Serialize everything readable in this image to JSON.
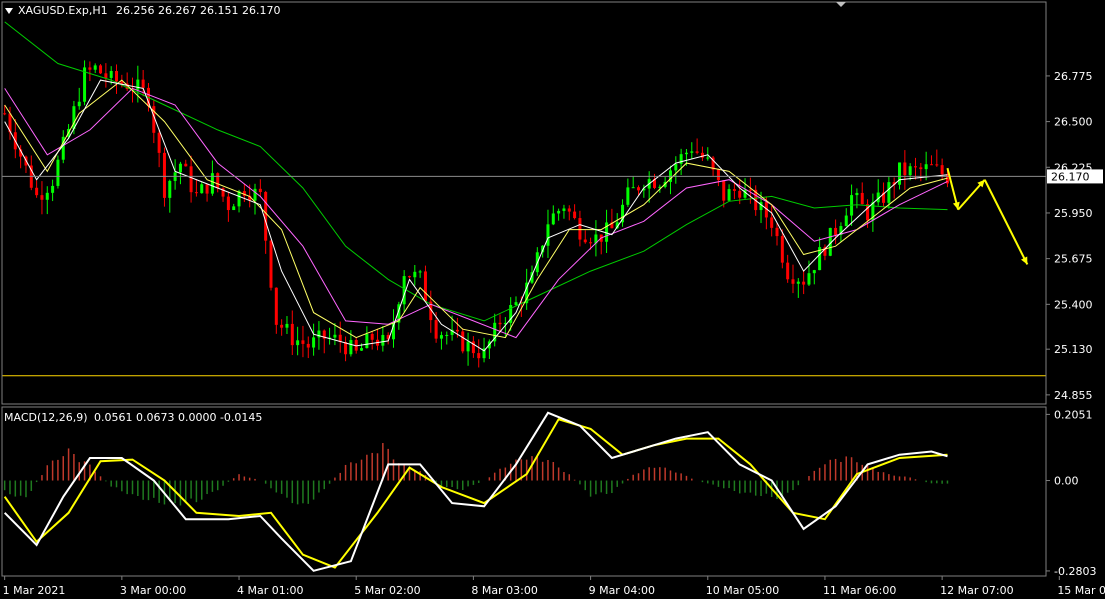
{
  "header": {
    "symbol": "XAGUSD.Exp,H1",
    "ohlc": "26.256 26.267 26.151 26.170"
  },
  "macd_header": {
    "label": "MACD(12,26,9)",
    "values": "0.0561 0.0673 0.0000 -0.0145"
  },
  "colors": {
    "background": "#000000",
    "bull_candle": "#00ff00",
    "bear_candle": "#ff0000",
    "ma_fast": "#ffffff",
    "ma_mid": "#ffff66",
    "ma_pink": "#ff66ff",
    "ma_slow": "#00cc00",
    "support_line": "#ffd700",
    "price_line": "#8c8c8c",
    "arrows": "#ffff00",
    "macd_line": "#ffffff",
    "signal_line": "#ffff00",
    "hist_pos": "#c0392b",
    "hist_neg": "#1f7a1f"
  },
  "icons": {
    "dropdown": "triangle-down-icon",
    "corner": "corner-triangle-icon"
  },
  "chart_data": [
    {
      "type": "line",
      "panel": "price",
      "title": "XAGUSD.Exp,H1",
      "y_ticks": [
        26.775,
        26.5,
        26.225,
        25.95,
        25.675,
        25.4,
        25.13,
        24.855
      ],
      "y_tick_labels": [
        "26.775",
        "26.500",
        "26.225",
        "25.950",
        "25.675",
        "25.400",
        "25.130",
        "24.855"
      ],
      "ylim": [
        24.8,
        27.22
      ],
      "current_price": 26.17,
      "current_price_label": "26.170",
      "support_level": 24.97,
      "x_labels": [
        "1 Mar 2021",
        "3 Mar 00:00",
        "4 Mar 01:00",
        "5 Mar 02:00",
        "8 Mar 03:00",
        "9 Mar 04:00",
        "10 Mar 05:00",
        "11 Mar 06:00",
        "12 Mar 07:00",
        "15 Mar 07:00"
      ],
      "close_path": [
        [
          0,
          26.55
        ],
        [
          3,
          26.3
        ],
        [
          6,
          26.05
        ],
        [
          9,
          26.15
        ],
        [
          12,
          26.45
        ],
        [
          15,
          26.78
        ],
        [
          17,
          26.82
        ],
        [
          20,
          26.75
        ],
        [
          24,
          26.72
        ],
        [
          27,
          26.65
        ],
        [
          30,
          26.1
        ],
        [
          33,
          26.25
        ],
        [
          36,
          26.05
        ],
        [
          39,
          26.15
        ],
        [
          42,
          26.0
        ],
        [
          45,
          26.1
        ],
        [
          48,
          26.05
        ],
        [
          51,
          25.3
        ],
        [
          54,
          25.2
        ],
        [
          57,
          25.15
        ],
        [
          60,
          25.2
        ],
        [
          63,
          25.18
        ],
        [
          66,
          25.1
        ],
        [
          69,
          25.2
        ],
        [
          72,
          25.15
        ],
        [
          75,
          25.6
        ],
        [
          78,
          25.55
        ],
        [
          81,
          25.25
        ],
        [
          84,
          25.2
        ],
        [
          87,
          25.15
        ],
        [
          90,
          25.1
        ],
        [
          93,
          25.3
        ],
        [
          96,
          25.4
        ],
        [
          99,
          25.55
        ],
        [
          102,
          25.9
        ],
        [
          105,
          26.0
        ],
        [
          108,
          25.85
        ],
        [
          111,
          25.8
        ],
        [
          114,
          25.85
        ],
        [
          117,
          26.05
        ],
        [
          120,
          26.15
        ],
        [
          123,
          26.15
        ],
        [
          126,
          26.25
        ],
        [
          129,
          26.35
        ],
        [
          132,
          26.25
        ],
        [
          135,
          26.05
        ],
        [
          138,
          26.1
        ],
        [
          141,
          26.0
        ],
        [
          144,
          25.9
        ],
        [
          147,
          25.6
        ],
        [
          150,
          25.55
        ],
        [
          153,
          25.7
        ],
        [
          156,
          25.85
        ],
        [
          159,
          26.05
        ],
        [
          162,
          25.95
        ],
        [
          165,
          26.05
        ],
        [
          168,
          26.2
        ],
        [
          171,
          26.2
        ],
        [
          174,
          26.22
        ],
        [
          177,
          26.17
        ]
      ],
      "ma_fast": [
        [
          0,
          26.5
        ],
        [
          6,
          26.15
        ],
        [
          12,
          26.4
        ],
        [
          18,
          26.75
        ],
        [
          26,
          26.7
        ],
        [
          32,
          26.2
        ],
        [
          40,
          26.1
        ],
        [
          48,
          26.0
        ],
        [
          52,
          25.6
        ],
        [
          58,
          25.22
        ],
        [
          66,
          25.15
        ],
        [
          72,
          25.18
        ],
        [
          76,
          25.55
        ],
        [
          82,
          25.28
        ],
        [
          90,
          25.12
        ],
        [
          96,
          25.35
        ],
        [
          102,
          25.8
        ],
        [
          108,
          25.88
        ],
        [
          114,
          25.82
        ],
        [
          120,
          26.1
        ],
        [
          126,
          26.25
        ],
        [
          132,
          26.3
        ],
        [
          138,
          26.1
        ],
        [
          144,
          25.95
        ],
        [
          150,
          25.6
        ],
        [
          156,
          25.8
        ],
        [
          162,
          25.98
        ],
        [
          168,
          26.15
        ],
        [
          177,
          26.18
        ]
      ],
      "ma_mid": [
        [
          0,
          26.6
        ],
        [
          8,
          26.2
        ],
        [
          14,
          26.55
        ],
        [
          22,
          26.75
        ],
        [
          30,
          26.5
        ],
        [
          38,
          26.15
        ],
        [
          46,
          26.05
        ],
        [
          52,
          25.85
        ],
        [
          58,
          25.35
        ],
        [
          66,
          25.2
        ],
        [
          74,
          25.3
        ],
        [
          78,
          25.5
        ],
        [
          86,
          25.25
        ],
        [
          94,
          25.2
        ],
        [
          100,
          25.55
        ],
        [
          106,
          25.85
        ],
        [
          112,
          25.85
        ],
        [
          120,
          26.0
        ],
        [
          128,
          26.25
        ],
        [
          136,
          26.2
        ],
        [
          144,
          26.0
        ],
        [
          150,
          25.7
        ],
        [
          156,
          25.75
        ],
        [
          164,
          25.95
        ],
        [
          170,
          26.1
        ],
        [
          177,
          26.16
        ]
      ],
      "ma_pink": [
        [
          0,
          26.7
        ],
        [
          8,
          26.3
        ],
        [
          16,
          26.45
        ],
        [
          24,
          26.7
        ],
        [
          32,
          26.6
        ],
        [
          40,
          26.25
        ],
        [
          48,
          26.05
        ],
        [
          56,
          25.75
        ],
        [
          64,
          25.3
        ],
        [
          72,
          25.28
        ],
        [
          80,
          25.4
        ],
        [
          88,
          25.3
        ],
        [
          96,
          25.2
        ],
        [
          104,
          25.55
        ],
        [
          112,
          25.8
        ],
        [
          120,
          25.9
        ],
        [
          128,
          26.1
        ],
        [
          136,
          26.15
        ],
        [
          144,
          26.0
        ],
        [
          152,
          25.78
        ],
        [
          160,
          25.85
        ],
        [
          168,
          26.0
        ],
        [
          177,
          26.14
        ]
      ],
      "ma_slow": [
        [
          0,
          27.1
        ],
        [
          10,
          26.85
        ],
        [
          20,
          26.75
        ],
        [
          30,
          26.6
        ],
        [
          40,
          26.45
        ],
        [
          48,
          26.35
        ],
        [
          56,
          26.1
        ],
        [
          64,
          25.75
        ],
        [
          72,
          25.55
        ],
        [
          80,
          25.4
        ],
        [
          90,
          25.3
        ],
        [
          100,
          25.45
        ],
        [
          110,
          25.6
        ],
        [
          120,
          25.72
        ],
        [
          128,
          25.88
        ],
        [
          136,
          26.02
        ],
        [
          144,
          26.05
        ],
        [
          152,
          25.98
        ],
        [
          160,
          26.0
        ],
        [
          168,
          25.98
        ],
        [
          177,
          25.97
        ]
      ],
      "forecast_arrows": [
        [
          [
            177,
            26.22
          ],
          [
            179,
            25.97
          ]
        ],
        [
          [
            179,
            25.97
          ],
          [
            184,
            26.15
          ]
        ],
        [
          [
            184,
            26.15
          ],
          [
            192,
            25.64
          ]
        ]
      ]
    },
    {
      "type": "line",
      "panel": "macd",
      "title": "MACD(12,26,9)",
      "y_ticks": [
        0.2051,
        0.0,
        -0.2803
      ],
      "y_tick_labels": [
        "0.2051",
        "0.00",
        "-0.2803"
      ],
      "ylim": [
        -0.296,
        0.228
      ],
      "macd": [
        [
          0,
          -0.1
        ],
        [
          6,
          -0.2
        ],
        [
          11,
          -0.05
        ],
        [
          16,
          0.07
        ],
        [
          22,
          0.07
        ],
        [
          28,
          0.0
        ],
        [
          34,
          -0.12
        ],
        [
          42,
          -0.12
        ],
        [
          48,
          -0.11
        ],
        [
          52,
          -0.18
        ],
        [
          58,
          -0.28
        ],
        [
          65,
          -0.25
        ],
        [
          72,
          0.05
        ],
        [
          78,
          0.05
        ],
        [
          84,
          -0.07
        ],
        [
          90,
          -0.08
        ],
        [
          96,
          0.05
        ],
        [
          102,
          0.21
        ],
        [
          108,
          0.17
        ],
        [
          114,
          0.07
        ],
        [
          120,
          0.1
        ],
        [
          126,
          0.13
        ],
        [
          132,
          0.15
        ],
        [
          138,
          0.05
        ],
        [
          144,
          0.0
        ],
        [
          150,
          -0.15
        ],
        [
          156,
          -0.08
        ],
        [
          162,
          0.05
        ],
        [
          168,
          0.08
        ],
        [
          174,
          0.09
        ],
        [
          177,
          0.075
        ]
      ],
      "signal": [
        [
          0,
          -0.05
        ],
        [
          6,
          -0.19
        ],
        [
          12,
          -0.1
        ],
        [
          18,
          0.06
        ],
        [
          24,
          0.065
        ],
        [
          30,
          0.0
        ],
        [
          36,
          -0.1
        ],
        [
          44,
          -0.11
        ],
        [
          50,
          -0.1
        ],
        [
          56,
          -0.23
        ],
        [
          62,
          -0.27
        ],
        [
          70,
          -0.1
        ],
        [
          76,
          0.04
        ],
        [
          82,
          -0.02
        ],
        [
          90,
          -0.07
        ],
        [
          98,
          0.02
        ],
        [
          104,
          0.19
        ],
        [
          110,
          0.16
        ],
        [
          116,
          0.08
        ],
        [
          122,
          0.11
        ],
        [
          128,
          0.13
        ],
        [
          134,
          0.13
        ],
        [
          140,
          0.05
        ],
        [
          148,
          -0.1
        ],
        [
          154,
          -0.12
        ],
        [
          160,
          0.02
        ],
        [
          168,
          0.07
        ],
        [
          177,
          0.08
        ]
      ],
      "histogram_envelope": [
        [
          0,
          -0.04
        ],
        [
          4,
          -0.06
        ],
        [
          8,
          0.05
        ],
        [
          12,
          0.1
        ],
        [
          16,
          0.05
        ],
        [
          20,
          -0.02
        ],
        [
          24,
          -0.05
        ],
        [
          28,
          -0.07
        ],
        [
          32,
          -0.08
        ],
        [
          36,
          -0.07
        ],
        [
          40,
          -0.03
        ],
        [
          44,
          0.02
        ],
        [
          48,
          0.0
        ],
        [
          52,
          -0.05
        ],
        [
          56,
          -0.09
        ],
        [
          60,
          -0.03
        ],
        [
          64,
          0.05
        ],
        [
          68,
          0.08
        ],
        [
          71,
          0.12
        ],
        [
          74,
          0.06
        ],
        [
          78,
          0.03
        ],
        [
          82,
          -0.02
        ],
        [
          86,
          -0.03
        ],
        [
          90,
          0.0
        ],
        [
          94,
          0.05
        ],
        [
          98,
          0.08
        ],
        [
          102,
          0.07
        ],
        [
          106,
          0.02
        ],
        [
          110,
          -0.05
        ],
        [
          114,
          -0.04
        ],
        [
          118,
          0.02
        ],
        [
          122,
          0.05
        ],
        [
          126,
          0.03
        ],
        [
          130,
          0.0
        ],
        [
          134,
          -0.02
        ],
        [
          138,
          -0.04
        ],
        [
          142,
          -0.05
        ],
        [
          146,
          -0.06
        ],
        [
          150,
          0.0
        ],
        [
          154,
          0.06
        ],
        [
          158,
          0.08
        ],
        [
          162,
          0.05
        ],
        [
          166,
          0.02
        ],
        [
          170,
          0.01
        ],
        [
          174,
          -0.01
        ],
        [
          177,
          -0.01
        ]
      ]
    }
  ]
}
